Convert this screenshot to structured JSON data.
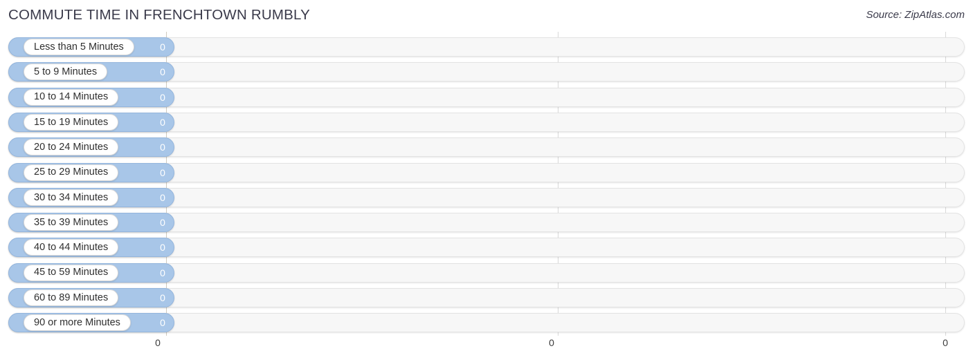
{
  "header": {
    "title": "COMMUTE TIME IN FRENCHTOWN RUMBLY",
    "source": "Source: ZipAtlas.com"
  },
  "chart_data": {
    "type": "bar",
    "orientation": "horizontal",
    "title": "COMMUTE TIME IN FRENCHTOWN RUMBLY",
    "subtitle": "Source: ZipAtlas.com",
    "xlabel": "",
    "ylabel": "",
    "grid": true,
    "legend": null,
    "xlim": [
      0,
      0
    ],
    "categories": [
      "Less than 5 Minutes",
      "5 to 9 Minutes",
      "10 to 14 Minutes",
      "15 to 19 Minutes",
      "20 to 24 Minutes",
      "25 to 29 Minutes",
      "30 to 34 Minutes",
      "35 to 39 Minutes",
      "40 to 44 Minutes",
      "45 to 59 Minutes",
      "60 to 89 Minutes",
      "90 or more Minutes"
    ],
    "values": [
      0,
      0,
      0,
      0,
      0,
      0,
      0,
      0,
      0,
      0,
      0,
      0
    ],
    "value_labels": [
      "0",
      "0",
      "0",
      "0",
      "0",
      "0",
      "0",
      "0",
      "0",
      "0",
      "0",
      "0"
    ],
    "x_ticks": [
      "0",
      "0",
      "0"
    ],
    "colors": {
      "bar": "#a8c6e8",
      "bar_border": "#93b5dd",
      "track": "#f7f7f7",
      "track_border": "#e3e3e3",
      "gridline": "#d8d8d8",
      "gridline_first": "#cfcabf",
      "label_capsule": "#ffffff",
      "text": "#2f2f2f",
      "value_text": "#ffffff"
    }
  },
  "bars": [
    {
      "label": "Less than 5 Minutes",
      "value": "0"
    },
    {
      "label": "5 to 9 Minutes",
      "value": "0"
    },
    {
      "label": "10 to 14 Minutes",
      "value": "0"
    },
    {
      "label": "15 to 19 Minutes",
      "value": "0"
    },
    {
      "label": "20 to 24 Minutes",
      "value": "0"
    },
    {
      "label": "25 to 29 Minutes",
      "value": "0"
    },
    {
      "label": "30 to 34 Minutes",
      "value": "0"
    },
    {
      "label": "35 to 39 Minutes",
      "value": "0"
    },
    {
      "label": "40 to 44 Minutes",
      "value": "0"
    },
    {
      "label": "45 to 59 Minutes",
      "value": "0"
    },
    {
      "label": "60 to 89 Minutes",
      "value": "0"
    },
    {
      "label": "90 or more Minutes",
      "value": "0"
    }
  ],
  "axis": {
    "ticks": [
      {
        "label": "0"
      },
      {
        "label": "0"
      },
      {
        "label": "0"
      }
    ]
  }
}
